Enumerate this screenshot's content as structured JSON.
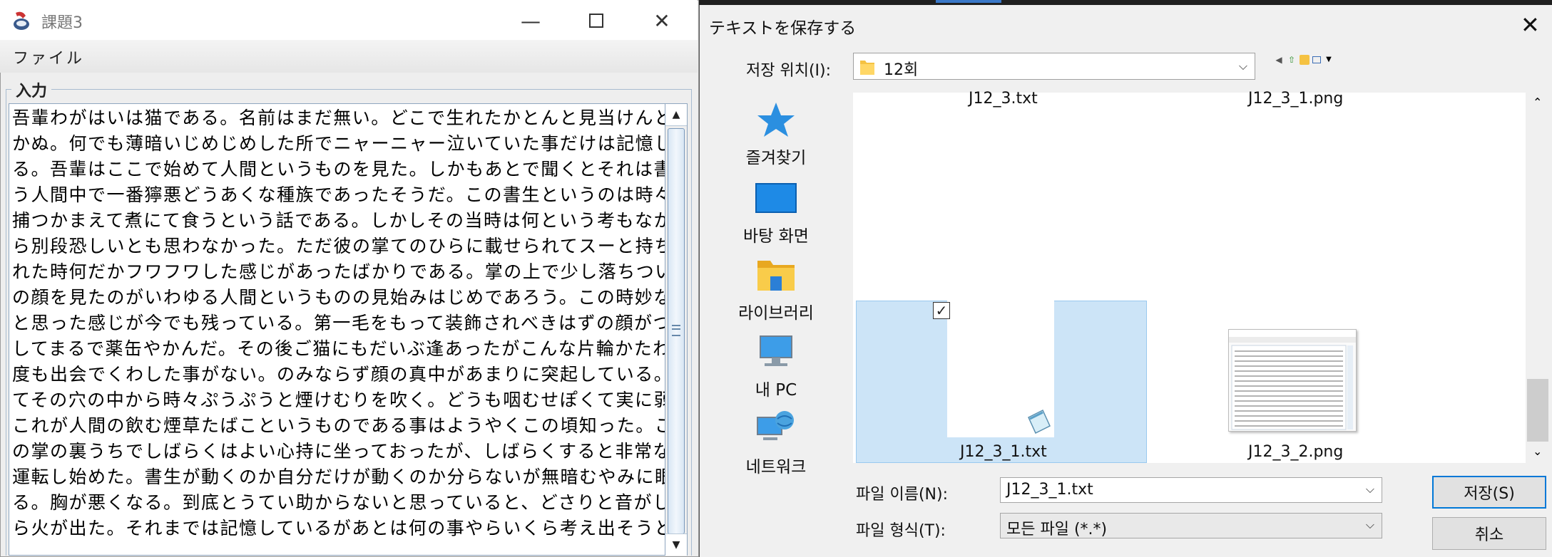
{
  "editor": {
    "title": "課題3",
    "menu_file": "ファイル",
    "group_label": "入力",
    "text": "吾輩わがはいは猫である。名前はまだ無い。どこで生れたかとんと見当けんとうがつ\nかぬ。何でも薄暗いじめじめした所でニャーニャー泣いていた事だけは記憶してい\nる。吾輩はここで始めて人間というものを見た。しかもあとで聞くとそれは書生とい\nう人間中で一番獰悪どうあくな種族であったそうだ。この書生というのは時々我々を\n捕つかまえて煮にて食うという話である。しかしその当時は何という考もなかったか\nら別段恐しいとも思わなかった。ただ彼の掌てのひらに載せられてスーと持ち上げら\nれた時何だかフワフワした感じがあったばかりである。掌の上で少し落ちついて書生\nの顔を見たのがいわゆる人間というものの見始みはじめであろう。この時妙なものだ\nと思った感じが今でも残っている。第一毛をもって装飾されべきはずの顔がつるつる\nしてまるで薬缶やかんだ。その後ご猫にもだいぶ逢あったがこんな片輪かたわには一\n度も出会でくわした事がない。のみならず顔の真中があまりに突起している。そうし\nてその穴の中から時々ぷうぷうと煙けむりを吹く。どうも咽むせぽくて実に弱った。\nこれが人間の飲む煙草たばこというものである事はようやくこの頃知った。この書生\nの掌の裏うちでしばらくはよい心持に坐っておったが、しばらくすると非常な速力で\n運転し始めた。書生が動くのか自分だけが動くのか分らないが無暗むやみに眼が廻\nる。胸が悪くなる。到底とうてい助からないと思っていると、どさりと音がして眼か\nら火が出た。それまでは記憶しているがあとは何の事やらいくら考え出そうとしても"
  },
  "dialog": {
    "title": "テキストを保存する",
    "lookin_label": "저장 위치(I):",
    "lookin_value": "12회",
    "places": [
      {
        "label": "즐겨찾기"
      },
      {
        "label": "바탕 화면"
      },
      {
        "label": "라이브러리"
      },
      {
        "label": "내 PC"
      },
      {
        "label": "네트워크"
      }
    ],
    "files": [
      {
        "name": "J12_3.txt"
      },
      {
        "name": "J12_3_1.png"
      },
      {
        "name": "J12_3_1.txt"
      },
      {
        "name": "J12_3_2.png"
      }
    ],
    "filename_label": "파일 이름(N):",
    "filename_value": "J12_3_1.txt",
    "filetype_label": "파일 형식(T):",
    "filetype_value": "모든 파일 (*.*)",
    "save_label": "저장(S)",
    "cancel_label": "취소"
  },
  "colors": {
    "selection": "#cce4f7",
    "accent": "#0078d7"
  }
}
